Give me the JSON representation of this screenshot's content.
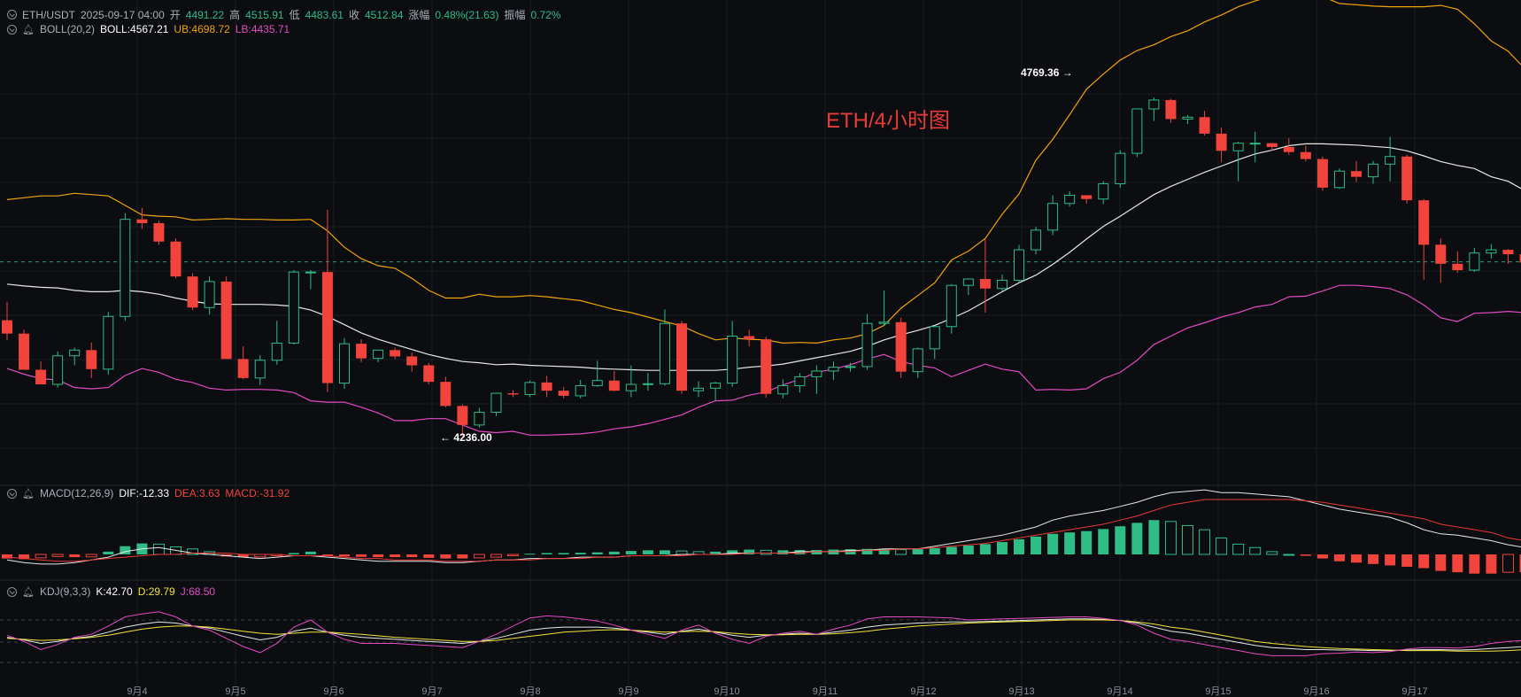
{
  "header": {
    "symbol": "ETH/USDT",
    "datetime": "2025-09-17 04:00",
    "open_label": "开",
    "open": "4491.22",
    "high_label": "高",
    "high": "4515.91",
    "low_label": "低",
    "low": "4483.61",
    "close_label": "收",
    "close": "4512.84",
    "change_label": "涨幅",
    "change": "0.48%(21.63)",
    "amp_label": "振幅",
    "amp": "0.72%"
  },
  "boll": {
    "name": "BOLL(20,2)",
    "mid": "BOLL:4567.21",
    "ub": "UB:4698.72",
    "lb": "LB:4435.71"
  },
  "macd": {
    "name": "MACD(12,26,9)",
    "dif": "DIF:-12.33",
    "dea": "DEA:3.63",
    "macd": "MACD:-31.92"
  },
  "kdj": {
    "name": "KDJ(9,3,3)",
    "k": "K:42.70",
    "d": "D:29.79",
    "j": "J:68.50"
  },
  "overlay_title": "ETH/4小时图",
  "annotations": {
    "high": "4769.36",
    "low": "4236.00"
  },
  "colors": {
    "up": "#2ebd85",
    "down": "#f0443c",
    "mid": "#e8e8e8",
    "ub": "#f0a30a",
    "lb": "#e24bc3",
    "dea": "#e83a36",
    "k": "#e8e8e8",
    "d": "#f4e33a",
    "j": "#e24bc3"
  },
  "chart_data": {
    "type": "candlestick",
    "x_tick_labels": [
      "9月4",
      "9月5",
      "9月6",
      "9月7",
      "9月8",
      "9月9",
      "9月10",
      "9月11",
      "9月12",
      "9月13",
      "9月14",
      "9月15",
      "9月16",
      "9月17"
    ],
    "candles": [
      [
        4421,
        4450,
        4390,
        4400
      ],
      [
        4400,
        4406,
        4344,
        4343
      ],
      [
        4343,
        4356,
        4322,
        4320
      ],
      [
        4320,
        4372,
        4315,
        4365
      ],
      [
        4365,
        4378,
        4350,
        4374
      ],
      [
        4374,
        4386,
        4330,
        4344
      ],
      [
        4344,
        4434,
        4335,
        4427
      ],
      [
        4427,
        4590,
        4420,
        4580
      ],
      [
        4580,
        4598,
        4565,
        4574
      ],
      [
        4574,
        4578,
        4540,
        4545
      ],
      [
        4545,
        4550,
        4487,
        4490
      ],
      [
        4490,
        4495,
        4437,
        4441
      ],
      [
        4441,
        4490,
        4430,
        4482
      ],
      [
        4482,
        4490,
        4367,
        4360
      ],
      [
        4360,
        4380,
        4328,
        4330
      ],
      [
        4330,
        4366,
        4319,
        4358
      ],
      [
        4358,
        4420,
        4351,
        4385
      ],
      [
        4385,
        4500,
        4383,
        4497
      ],
      [
        4497,
        4500,
        4470,
        4497
      ],
      [
        4497,
        4595,
        4308,
        4322
      ],
      [
        4322,
        4393,
        4313,
        4384
      ],
      [
        4384,
        4391,
        4355,
        4361
      ],
      [
        4361,
        4375,
        4355,
        4374
      ],
      [
        4374,
        4378,
        4360,
        4364
      ],
      [
        4364,
        4370,
        4340,
        4350
      ],
      [
        4350,
        4354,
        4320,
        4324
      ],
      [
        4324,
        4332,
        4284,
        4286
      ],
      [
        4286,
        4289,
        4238,
        4256
      ],
      [
        4256,
        4283,
        4252,
        4276
      ],
      [
        4276,
        4307,
        4270,
        4306
      ],
      [
        4306,
        4311,
        4300,
        4304
      ],
      [
        4304,
        4326,
        4300,
        4323
      ],
      [
        4323,
        4333,
        4300,
        4310
      ],
      [
        4310,
        4316,
        4298,
        4302
      ],
      [
        4302,
        4327,
        4298,
        4318
      ],
      [
        4318,
        4357,
        4316,
        4326
      ],
      [
        4326,
        4341,
        4309,
        4310
      ],
      [
        4310,
        4350,
        4300,
        4320
      ],
      [
        4320,
        4338,
        4310,
        4321
      ],
      [
        4321,
        4438,
        4318,
        4416
      ],
      [
        4416,
        4420,
        4305,
        4310
      ],
      [
        4310,
        4325,
        4300,
        4314
      ],
      [
        4314,
        4324,
        4294,
        4322
      ],
      [
        4322,
        4420,
        4316,
        4396
      ],
      [
        4396,
        4406,
        4380,
        4391
      ],
      [
        4391,
        4395,
        4299,
        4305
      ],
      [
        4305,
        4328,
        4298,
        4318
      ],
      [
        4318,
        4338,
        4307,
        4332
      ],
      [
        4332,
        4350,
        4305,
        4341
      ],
      [
        4341,
        4356,
        4327,
        4347
      ],
      [
        4347,
        4354,
        4340,
        4348
      ],
      [
        4348,
        4431,
        4343,
        4416
      ],
      [
        4416,
        4468,
        4412,
        4418
      ],
      [
        4418,
        4425,
        4330,
        4340
      ],
      [
        4340,
        4378,
        4330,
        4376
      ],
      [
        4376,
        4412,
        4360,
        4411
      ],
      [
        4411,
        4478,
        4400,
        4476
      ],
      [
        4476,
        4487,
        4461,
        4486
      ],
      [
        4486,
        4549,
        4433,
        4471
      ],
      [
        4471,
        4493,
        4467,
        4484
      ],
      [
        4484,
        4540,
        4480,
        4532
      ],
      [
        4532,
        4568,
        4525,
        4563
      ],
      [
        4563,
        4618,
        4555,
        4605
      ],
      [
        4605,
        4624,
        4600,
        4618
      ],
      [
        4618,
        4614,
        4605,
        4612
      ],
      [
        4612,
        4640,
        4604,
        4636
      ],
      [
        4636,
        4689,
        4630,
        4684
      ],
      [
        4684,
        4754,
        4678,
        4754
      ],
      [
        4754,
        4772,
        4735,
        4768
      ],
      [
        4768,
        4770,
        4732,
        4738
      ],
      [
        4738,
        4744,
        4730,
        4741
      ],
      [
        4741,
        4751,
        4712,
        4715
      ],
      [
        4715,
        4725,
        4670,
        4688
      ],
      [
        4688,
        4702,
        4640,
        4700
      ],
      [
        4700,
        4718,
        4670,
        4700
      ],
      [
        4700,
        4700,
        4688,
        4694
      ],
      [
        4694,
        4708,
        4682,
        4686
      ],
      [
        4686,
        4696,
        4671,
        4675
      ],
      [
        4675,
        4679,
        4625,
        4630
      ],
      [
        4630,
        4660,
        4628,
        4656
      ],
      [
        4656,
        4672,
        4639,
        4647
      ],
      [
        4647,
        4672,
        4636,
        4667
      ],
      [
        4667,
        4710,
        4640,
        4679
      ],
      [
        4679,
        4682,
        4605,
        4610
      ],
      [
        4610,
        4612,
        4485,
        4540
      ],
      [
        4540,
        4550,
        4480,
        4510
      ],
      [
        4510,
        4530,
        4496,
        4500
      ],
      [
        4500,
        4535,
        4497,
        4527
      ],
      [
        4527,
        4541,
        4518,
        4532
      ],
      [
        4532,
        4533,
        4510,
        4525
      ],
      [
        4525,
        4532,
        4507,
        4512
      ],
      [
        4512,
        4520,
        4485,
        4489
      ],
      [
        4489,
        4499,
        4440,
        4491
      ],
      [
        4491,
        4516,
        4484,
        4513
      ]
    ],
    "boll_mid": [
      4478,
      4475,
      4473,
      4472,
      4468,
      4466,
      4466,
      4468,
      4466,
      4462,
      4456,
      4451,
      4447,
      4446,
      4446,
      4446,
      4445,
      4443,
      4437,
      4427,
      4414,
      4401,
      4391,
      4383,
      4375,
      4367,
      4361,
      4356,
      4354,
      4351,
      4352,
      4350,
      4349,
      4348,
      4347,
      4345,
      4344,
      4343,
      4342,
      4342,
      4342,
      4342,
      4342,
      4344,
      4347,
      4349,
      4352,
      4357,
      4362,
      4367,
      4372,
      4380,
      4390,
      4398,
      4405,
      4413,
      4424,
      4436,
      4451,
      4466,
      4480,
      4492,
      4509,
      4528,
      4549,
      4569,
      4585,
      4602,
      4619,
      4632,
      4643,
      4654,
      4664,
      4674,
      4683,
      4689,
      4696,
      4699,
      4699,
      4698,
      4697,
      4695,
      4693,
      4688,
      4680,
      4671,
      4665,
      4660,
      4647,
      4640,
      4625,
      4582,
      4570,
      4567
    ],
    "boll_ub": [
      4611,
      4614,
      4617,
      4617,
      4621,
      4619,
      4617,
      4602,
      4587,
      4585,
      4584,
      4579,
      4580,
      4581,
      4580,
      4580,
      4579,
      4579,
      4580,
      4562,
      4536,
      4518,
      4507,
      4503,
      4487,
      4468,
      4456,
      4456,
      4462,
      4458,
      4458,
      4460,
      4458,
      4455,
      4452,
      4445,
      4438,
      4433,
      4426,
      4419,
      4412,
      4400,
      4390,
      4393,
      4391,
      4390,
      4385,
      4386,
      4385,
      4390,
      4393,
      4400,
      4413,
      4440,
      4460,
      4480,
      4516,
      4530,
      4550,
      4588,
      4620,
      4673,
      4706,
      4745,
      4785,
      4809,
      4831,
      4846,
      4855,
      4868,
      4877,
      4891,
      4902,
      4915,
      4924,
      4932,
      4934,
      4939,
      4931,
      4920,
      4918,
      4916,
      4915,
      4915,
      4915,
      4917,
      4911,
      4888,
      4861,
      4845,
      4817,
      4795,
      4720,
      4699
    ],
    "boll_lb": [
      4345,
      4336,
      4329,
      4327,
      4315,
      4313,
      4315,
      4334,
      4345,
      4339,
      4328,
      4323,
      4314,
      4311,
      4312,
      4312,
      4311,
      4307,
      4294,
      4292,
      4292,
      4284,
      4275,
      4263,
      4263,
      4266,
      4266,
      4256,
      4246,
      4244,
      4246,
      4240,
      4240,
      4241,
      4242,
      4245,
      4250,
      4253,
      4258,
      4265,
      4272,
      4284,
      4294,
      4295,
      4303,
      4308,
      4319,
      4328,
      4339,
      4344,
      4351,
      4360,
      4367,
      4356,
      4350,
      4346,
      4332,
      4342,
      4352,
      4344,
      4340,
      4311,
      4312,
      4311,
      4313,
      4329,
      4339,
      4358,
      4383,
      4396,
      4409,
      4417,
      4426,
      4433,
      4442,
      4446,
      4458,
      4459,
      4467,
      4476,
      4476,
      4474,
      4471,
      4461,
      4445,
      4425,
      4419,
      4432,
      4433,
      4435,
      4433,
      4369,
      4420,
      4435
    ],
    "macd_hist": [
      -3.0,
      -3.5,
      -2.5,
      -1.5,
      -2.0,
      -1.8,
      2.0,
      6.0,
      8.0,
      7.5,
      5.5,
      4.0,
      2.0,
      -1.5,
      -2.0,
      -1.8,
      -1.0,
      1.0,
      2.0,
      -1.0,
      -1.5,
      -1.8,
      -2.0,
      -2.0,
      -2.0,
      -2.5,
      -3.0,
      -3.0,
      -2.5,
      -2.0,
      -1.0,
      0.5,
      1.0,
      1.0,
      1.2,
      1.5,
      2.0,
      2.5,
      3.0,
      3.0,
      2.5,
      2.0,
      2.0,
      3.0,
      3.5,
      3.0,
      3.0,
      3.2,
      3.2,
      3.5,
      3.8,
      4.0,
      4.0,
      3.5,
      3.8,
      4.5,
      5.5,
      6.5,
      7.5,
      9.0,
      11.0,
      13.0,
      15.0,
      16.0,
      17.0,
      18.5,
      20.5,
      23.0,
      25.0,
      24.0,
      21.0,
      18.0,
      12.0,
      7.5,
      5.0,
      2.0,
      0.0,
      -1.0,
      -3.0,
      -5.0,
      -6.0,
      -7.0,
      -8.0,
      -9.0,
      -10.0,
      -12.0,
      -13.0,
      -14.0,
      -14.0,
      -13.0,
      -13.0,
      -12.0,
      -11.0,
      -10.0
    ],
    "macd_dif": [
      -4,
      -6,
      -7,
      -7,
      -6,
      -4,
      -2,
      2,
      4,
      5,
      3,
      1,
      0,
      -1,
      -2,
      -3,
      -2,
      -1,
      -1,
      -2,
      -3,
      -4,
      -5,
      -5,
      -5,
      -5,
      -6,
      -6,
      -5,
      -4,
      -4,
      -3,
      -3,
      -3,
      -2,
      -2,
      -2,
      -1,
      -1,
      -1,
      0,
      0,
      0,
      1,
      1,
      1,
      1,
      2,
      2,
      2,
      3,
      3,
      4,
      4,
      4,
      6,
      8,
      10,
      12,
      14,
      17,
      20,
      25,
      28,
      30,
      32,
      35,
      38,
      42,
      45,
      46,
      47,
      45,
      45,
      44,
      43,
      42,
      39,
      36,
      33,
      31,
      29,
      27,
      23,
      18,
      15,
      14,
      12,
      10,
      7,
      5,
      3,
      2,
      2
    ],
    "macd_dea": [
      -2,
      -3,
      -4,
      -5,
      -5,
      -4,
      -3,
      -2,
      -1,
      0,
      0,
      1,
      1,
      1,
      0,
      0,
      0,
      -1,
      -1,
      -1,
      -2,
      -3,
      -3,
      -4,
      -4,
      -4,
      -5,
      -5,
      -5,
      -4,
      -4,
      -4,
      -3,
      -3,
      -3,
      -2,
      -2,
      -1,
      -1,
      -1,
      -1,
      0,
      0,
      0,
      1,
      1,
      1,
      1,
      2,
      2,
      2,
      3,
      3,
      4,
      4,
      5,
      6,
      7,
      8,
      10,
      12,
      14,
      16,
      18,
      20,
      22,
      25,
      28,
      32,
      36,
      38,
      40,
      40,
      40,
      40,
      40,
      40,
      39,
      38,
      36,
      34,
      32,
      30,
      28,
      26,
      22,
      20,
      18,
      16,
      12,
      10,
      7,
      5,
      4
    ],
    "kdj_k": [
      60,
      55,
      48,
      52,
      58,
      62,
      70,
      80,
      86,
      90,
      88,
      82,
      78,
      70,
      62,
      55,
      60,
      72,
      78,
      70,
      64,
      60,
      58,
      56,
      54,
      52,
      50,
      48,
      52,
      58,
      66,
      74,
      78,
      80,
      80,
      80,
      78,
      74,
      70,
      66,
      72,
      76,
      70,
      64,
      60,
      64,
      66,
      68,
      66,
      70,
      74,
      80,
      84,
      86,
      88,
      89,
      90,
      90,
      91,
      92,
      93,
      94,
      95,
      96,
      96,
      95,
      93,
      88,
      80,
      72,
      68,
      62,
      56,
      50,
      44,
      40,
      38,
      36,
      36,
      35,
      35,
      34,
      34,
      35,
      36,
      36,
      35,
      36,
      38,
      40,
      42
    ],
    "kdj_d": [
      58,
      56,
      54,
      55,
      57,
      60,
      64,
      70,
      76,
      80,
      82,
      82,
      80,
      76,
      72,
      68,
      66,
      68,
      70,
      70,
      68,
      66,
      63,
      60,
      58,
      56,
      54,
      52,
      52,
      54,
      58,
      62,
      66,
      70,
      72,
      74,
      75,
      74,
      72,
      70,
      71,
      72,
      71,
      68,
      66,
      65,
      65,
      66,
      66,
      67,
      69,
      72,
      76,
      79,
      82,
      84,
      86,
      88,
      89,
      90,
      91,
      92,
      93,
      94,
      94,
      94,
      93,
      90,
      86,
      80,
      76,
      70,
      64,
      58,
      52,
      48,
      45,
      42,
      40,
      38,
      37,
      36,
      35,
      34,
      34,
      34,
      33,
      33,
      33,
      34,
      36
    ],
    "kdj_j": [
      64,
      52,
      36,
      46,
      60,
      66,
      82,
      100,
      106,
      110,
      100,
      82,
      74,
      58,
      42,
      30,
      48,
      80,
      94,
      70,
      56,
      48,
      48,
      48,
      46,
      44,
      42,
      40,
      52,
      66,
      82,
      98,
      102,
      100,
      96,
      92,
      84,
      74,
      66,
      58,
      74,
      84,
      68,
      56,
      48,
      62,
      68,
      72,
      66,
      76,
      84,
      96,
      100,
      100,
      100,
      99,
      98,
      94,
      95,
      96,
      97,
      98,
      99,
      100,
      100,
      97,
      93,
      84,
      68,
      56,
      52,
      46,
      40,
      34,
      28,
      24,
      24,
      24,
      28,
      29,
      31,
      30,
      32,
      37,
      40,
      40,
      39,
      42,
      48,
      52,
      54
    ]
  }
}
